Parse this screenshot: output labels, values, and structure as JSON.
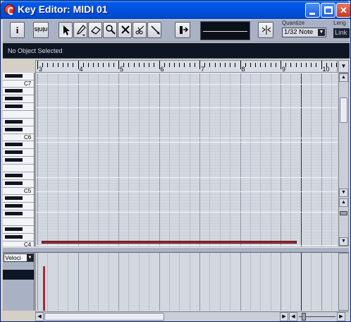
{
  "window": {
    "title": "Key Editor: MIDI 01",
    "icon": "cubase-icon",
    "controls": {
      "minimize": "minimize-icon",
      "maximize": "maximize-icon",
      "close": "close-icon"
    }
  },
  "toolbar": {
    "info_button_label": "i",
    "solo_button_label": "S|U|U",
    "tools": [
      "arrow-icon",
      "pencil-icon",
      "eraser-icon",
      "magnifier-icon",
      "mute-icon",
      "split-icon",
      "glue-icon"
    ],
    "colorize_icon": "colorize-icon",
    "snap_icon": "snap-icon",
    "quantize_label": "Quantize",
    "quantize_value": "1/32 Note",
    "length_label": "Leng",
    "length_value": "Link"
  },
  "info_line": {
    "status": "No Object Selected"
  },
  "ruler": {
    "bars": [
      "3",
      "4",
      "5",
      "6",
      "7",
      "8",
      "9",
      "10"
    ]
  },
  "keyboard": {
    "labels": [
      "C7",
      "C6",
      "C5",
      "C4"
    ]
  },
  "velocity_lane": {
    "selector_value": "Veloci"
  },
  "notes": [
    {
      "start_bar": 3.1,
      "end_bar": 9.4
    }
  ],
  "colors": {
    "titlebar": "#0050dc",
    "note": "#a8293a",
    "grid_bg": "#d3d8e0",
    "toolbar_bg": "#a9b2c4",
    "info_bg": "#0e1624"
  }
}
